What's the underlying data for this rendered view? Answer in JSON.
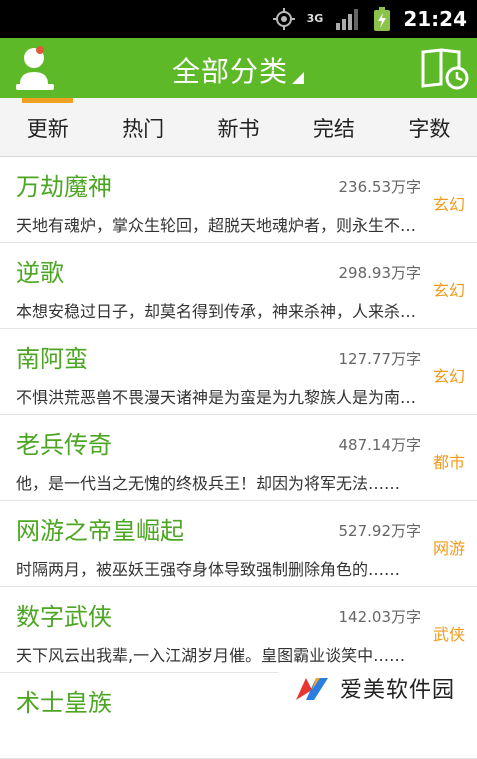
{
  "status_bar": {
    "time": "21:24",
    "network": "3G"
  },
  "header": {
    "title": "全部分类"
  },
  "tabs": [
    {
      "label": "更新",
      "active": true
    },
    {
      "label": "热门",
      "active": false
    },
    {
      "label": "新书",
      "active": false
    },
    {
      "label": "完结",
      "active": false
    },
    {
      "label": "字数",
      "active": false
    }
  ],
  "books": [
    {
      "title": "万劫魔神",
      "size": "236.53万字",
      "category": "玄幻",
      "desc": "天地有魂炉，掌众生轮回，超脱天地魂炉者，则永生不灭……"
    },
    {
      "title": "逆歌",
      "size": "298.93万字",
      "category": "玄幻",
      "desc": "本想安稳过日子，却莫名得到传承，神来杀神，人来杀人……"
    },
    {
      "title": "南阿蛮",
      "size": "127.77万字",
      "category": "玄幻",
      "desc": "不惧洪荒恶兽不畏漫天诸神是为蛮是为九黎族人是为南阿蛮"
    },
    {
      "title": "老兵传奇",
      "size": "487.14万字",
      "category": "都市",
      "desc": "他，是一代当之无愧的终极兵王！却因为将军无法……"
    },
    {
      "title": "网游之帝皇崛起",
      "size": "527.92万字",
      "category": "网游",
      "desc": "时隔两月，被巫妖王强夺身体导致强制删除角色的……"
    },
    {
      "title": "数字武侠",
      "size": "142.03万字",
      "category": "武侠",
      "desc": "天下风云出我辈,一入江湖岁月催。皇图霸业谈笑中……"
    },
    {
      "title": "术士皇族",
      "size": "",
      "category": "",
      "desc": ""
    }
  ],
  "watermark": {
    "text": "爱美软件园"
  },
  "colors": {
    "brand_green": "#5db928",
    "title_green": "#4da623",
    "accent_orange": "#f29a1a",
    "tab_indicator": "#f0a020"
  }
}
